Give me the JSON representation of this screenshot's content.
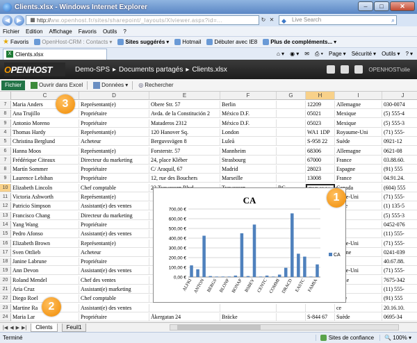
{
  "window": {
    "title": "Clients.xlsx - Windows Internet Explorer"
  },
  "address": {
    "prefix": "http://",
    "blurred": "ww.openhost.fr/sites/sharepoint/_layouts/Xlviewer.aspx?id=...",
    "search_placeholder": "Live Search"
  },
  "menu": [
    "Fichier",
    "Edition",
    "Affichage",
    "Favoris",
    "Outils",
    "?"
  ],
  "favorites": {
    "label": "Favoris",
    "items": [
      "OpenHost-CRM : Contacts",
      "Sites suggérés",
      "Hotmail",
      "Débuter avec IE8",
      "Plus de compléments..."
    ]
  },
  "tab": {
    "label": "Clients.xlsx"
  },
  "commands": [
    "Page",
    "Sécurité",
    "Outils",
    "?"
  ],
  "sharepoint": {
    "logo_o": "O",
    "logo_rest": "PENHOST",
    "breadcrumb": [
      "Demo-SPS",
      "Documents partagés",
      "Clients.xlsx"
    ],
    "user": "OPENHOST\\olie"
  },
  "ribbon": {
    "file": "Fichier",
    "open_excel": "Ouvrir dans Excel",
    "data": "Données",
    "find": "Rechercher"
  },
  "grid": {
    "columns": [
      "C",
      "D",
      "E",
      "F",
      "G",
      "H",
      "I",
      "J"
    ],
    "selected_column": "H",
    "selected_row": "10",
    "rows": [
      {
        "n": "7",
        "C": "Maria Anders",
        "D": "Représentant(e)",
        "E": "Obere Str. 57",
        "F": "Berlin",
        "G": "",
        "H": "12209",
        "I": "Allemagne",
        "J": "030-0074"
      },
      {
        "n": "8",
        "C": "Ana Trujillo",
        "D": "Propriétaire",
        "E": "Avda. de la Constitución 2",
        "F": "México D.F.",
        "G": "",
        "H": "05021",
        "I": "Mexique",
        "J": "(5) 555-4"
      },
      {
        "n": "9",
        "C": "Antonio Moreno",
        "D": "Propriétaire",
        "E": "Mataderos  2312",
        "F": "México D.F.",
        "G": "",
        "H": "05023",
        "I": "Mexique",
        "J": "(5) 555-3"
      },
      {
        "n": "4",
        "C": "Thomas Hardy",
        "D": "Représentant(e)",
        "E": "120 Hanover Sq.",
        "F": "London",
        "G": "",
        "H": "WA1 1DP",
        "I": "Royaume-Uni",
        "J": "(71) 555-"
      },
      {
        "n": "5",
        "C": "Christina Berglund",
        "D": "Acheteur",
        "E": "Berguvsvägen  8",
        "F": "Luleå",
        "G": "",
        "H": "S-958 22",
        "I": "Suède",
        "J": "0921-12"
      },
      {
        "n": "6",
        "C": "Hanna Moos",
        "D": "Représentant(e)",
        "E": "Forsterstr. 57",
        "F": "Mannheim",
        "G": "",
        "H": "68306",
        "I": "Allemagne",
        "J": "0621-08"
      },
      {
        "n": "7",
        "C": "Frédérique Citeaux",
        "D": "Directeur du marketing",
        "E": "24, place Kléber",
        "F": "Strasbourg",
        "G": "",
        "H": "67000",
        "I": "France",
        "J": "03.88.60."
      },
      {
        "n": "8",
        "C": "Martín Sommer",
        "D": "Propriétaire",
        "E": "C/ Araquil, 67",
        "F": "Madrid",
        "G": "",
        "H": "28023",
        "I": "Espagne",
        "J": "(91) 555"
      },
      {
        "n": "9",
        "C": "Laurence Lebihan",
        "D": "Propriétaire",
        "E": "12, rue des Bouchers",
        "F": "Marseille",
        "G": "",
        "H": "13008",
        "I": "France",
        "J": "04.91.24."
      },
      {
        "n": "10",
        "C": "Elizabeth Lincoln",
        "D": "Chef comptable",
        "E": "23 Tsawassen Blvd.",
        "F": "Tsawassen",
        "G": "BC",
        "H": "T2F 8M4",
        "I": "Canada",
        "J": "(604) 555"
      },
      {
        "n": "11",
        "C": "Victoria Ashworth",
        "D": "Représentant(e)",
        "E": "",
        "F": "",
        "G": "",
        "H": "",
        "I": "aume-Uni",
        "J": "(71) 555-"
      },
      {
        "n": "12",
        "C": "Patricio Simpson",
        "D": "Assistant(e) des ventes",
        "E": "",
        "F": "",
        "G": "",
        "H": "",
        "I": "ntine",
        "J": "(1) 135-5"
      },
      {
        "n": "13",
        "C": "Francisco Chang",
        "D": "Directeur du marketing",
        "E": "",
        "F": "",
        "G": "",
        "H": "",
        "I": "que",
        "J": "(5) 555-3"
      },
      {
        "n": "14",
        "C": "Yang Wang",
        "D": "Propriétaire",
        "E": "",
        "F": "",
        "G": "",
        "H": "",
        "I": "se",
        "J": "0452-076"
      },
      {
        "n": "15",
        "C": "Pedro Afonso",
        "D": "Assistant(e) des ventes",
        "E": "",
        "F": "",
        "G": "",
        "H": "",
        "I": "sil",
        "J": "(11) 555-"
      },
      {
        "n": "16",
        "C": "Elizabeth Brown",
        "D": "Représentant(e)",
        "E": "",
        "F": "",
        "G": "",
        "H": "",
        "I": "aume-Uni",
        "J": "(71) 555-"
      },
      {
        "n": "17",
        "C": "Sven Ottlieb",
        "D": "Acheteur",
        "E": "",
        "F": "",
        "G": "",
        "H": "",
        "I": "magne",
        "J": "0241-039"
      },
      {
        "n": "18",
        "C": "Janine Labrune",
        "D": "Propriétaire",
        "E": "",
        "F": "",
        "G": "",
        "H": "",
        "I": "ce",
        "J": "40.67.88."
      },
      {
        "n": "19",
        "C": "Ann Devon",
        "D": "Assistant(e) des ventes",
        "E": "",
        "F": "",
        "G": "",
        "H": "",
        "I": "aume-Uni",
        "J": "(71) 555-"
      },
      {
        "n": "20",
        "C": "Roland Mendel",
        "D": "Chef des ventes",
        "E": "",
        "F": "",
        "G": "",
        "H": "",
        "I": "triche",
        "J": "7675-342"
      },
      {
        "n": "21",
        "C": "Aria Cruz",
        "D": "Assistant(e) marketing",
        "E": "",
        "F": "",
        "G": "",
        "H": "",
        "I": "sil",
        "J": "(11) 555-"
      },
      {
        "n": "22",
        "C": "Diego Roel",
        "D": "Chef comptable",
        "E": "",
        "F": "",
        "G": "",
        "H": "",
        "I": "agne",
        "J": "(91) 555"
      },
      {
        "n": "23",
        "C": "Martine Ra",
        "D": "Assistant(e) des ventes",
        "E": "",
        "F": "",
        "G": "",
        "H": "",
        "I": "ce",
        "J": "20.16.10."
      },
      {
        "n": "24",
        "C": "Maria Lar",
        "D": "Propriétaire",
        "E": "Åkergatan 24",
        "F": "Bräcke",
        "G": "",
        "H": "S-844 67",
        "I": "Suède",
        "J": "0695-34"
      },
      {
        "n": "25",
        "C": "Peter Franken",
        "D": "Directeur du marketing",
        "E": "Berliner Platz 43",
        "F": "München",
        "G": "",
        "H": "80805",
        "I": "Allemagne",
        "J": "089-087"
      }
    ]
  },
  "chart_data": {
    "type": "bar",
    "title": "CA",
    "legend": "CA",
    "legend_position": "right",
    "ylim": [
      0,
      700
    ],
    "yticks": [
      "0,00 €",
      "100,00 €",
      "200,00 €",
      "300,00 €",
      "400,00 €",
      "500,00 €",
      "600,00 €",
      "700,00 €"
    ],
    "grid": true,
    "color": "#4f81bd",
    "categories": [
      "ALFKI",
      "",
      "ANTON",
      "",
      "BERGS",
      "",
      "BLONP",
      "",
      "BONAP",
      "",
      "BSBEV",
      "",
      "CENTC",
      "",
      "COMMI",
      "",
      "DRACD",
      "",
      "EASTC",
      "",
      "FAMIA",
      ""
    ],
    "values": [
      120,
      80,
      425,
      10,
      5,
      5,
      5,
      15,
      450,
      10,
      540,
      5,
      15,
      5,
      25,
      95,
      655,
      240,
      210,
      5,
      130
    ],
    "xlabels": [
      "ALFKI",
      "ANTON",
      "BERGS",
      "BLONP",
      "BONAP",
      "BSBEV",
      "CENTC",
      "COMMI",
      "DRACD",
      "EASTC",
      "FAMIA"
    ]
  },
  "callouts": [
    "1",
    "2",
    "3"
  ],
  "sheets": [
    "Clients",
    "Feuil1"
  ],
  "status": {
    "left": "Terminé",
    "zone": "Sites de confiance",
    "zoom": "100%"
  }
}
